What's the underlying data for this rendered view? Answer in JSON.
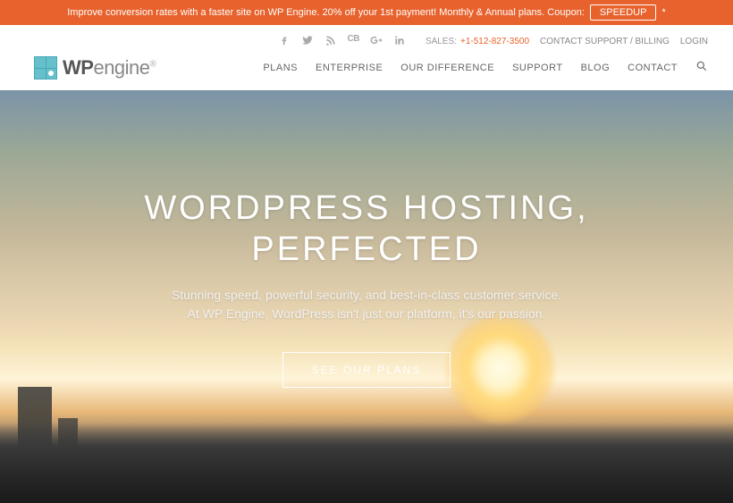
{
  "promo": {
    "text": "Improve conversion rates with a faster site on WP Engine. 20% off your 1st payment! Monthly & Annual plans. Coupon:",
    "coupon": "SPEEDUP",
    "asterisk": "*"
  },
  "topbar": {
    "sales_label": "SALES:",
    "phone": "+1-512-827-3500",
    "support_link": "CONTACT SUPPORT / BILLING",
    "login": "LOGIN"
  },
  "logo": {
    "wp": "WP",
    "engine": "engine",
    "reg": "®"
  },
  "nav": {
    "items": [
      "PLANS",
      "ENTERPRISE",
      "OUR DIFFERENCE",
      "SUPPORT",
      "BLOG",
      "CONTACT"
    ]
  },
  "hero": {
    "title_line1": "WORDPRESS HOSTING,",
    "title_line2": "PERFECTED",
    "sub_line1": "Stunning speed, powerful security, and best-in-class customer service.",
    "sub_line2": "At WP Engine, WordPress isn't just our platform, it's our passion.",
    "cta": "SEE OUR PLANS"
  }
}
